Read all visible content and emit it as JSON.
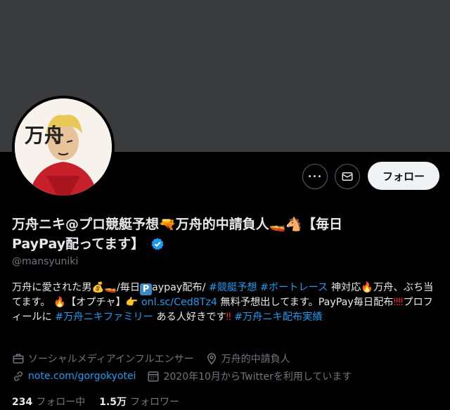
{
  "profile": {
    "name": "万舟ニキ@プロ競艇予想🔫万舟的中請負人🚤🐴【毎日PayPay配ってます】",
    "name_part1": "万舟ニキ@プロ競艇予想",
    "name_part2": "万舟的中請負人",
    "name_part3": "【毎日",
    "name_part4": "PayPay配ってます】",
    "handle": "@mansyuniki",
    "avatar_text": "万舟"
  },
  "actions": {
    "more_label": "•••",
    "follow_label": "フォロー"
  },
  "bio": {
    "t1": "万舟に愛された男",
    "t2": "/毎日",
    "t3": "aypay配布/ ",
    "tag1": "#競艇予想",
    "tag2": "#ボートレース",
    "t4": " 神対応",
    "t5": "万舟、ぶち当てます。",
    "t6": "【オプチャ】",
    "link": "onl.sc/Ced8Tz4",
    "t7": " 無料予想出してます。PayPay毎日配布",
    "t8": "プロフィールに ",
    "tag3": "#万舟ニキファミリー",
    "t9": " ある人好きです",
    "tag4": "#万舟ニキ配布実績"
  },
  "meta": {
    "category": "ソーシャルメディアインフルエンサー",
    "location": "万舟的中請負人",
    "website": "note.com/gorgokyotei",
    "joined": "2020年10月からTwitterを利用しています"
  },
  "stats": {
    "following_count": "234",
    "following_label": "フォロー中",
    "followers_count": "1.5万",
    "followers_label": "フォロワー"
  },
  "colors": {
    "background": "#000000",
    "banner": "#3a3b3d",
    "link": "#1d9bf0",
    "secondary_text": "#71767b",
    "follow_button_bg": "#eff3f4"
  }
}
